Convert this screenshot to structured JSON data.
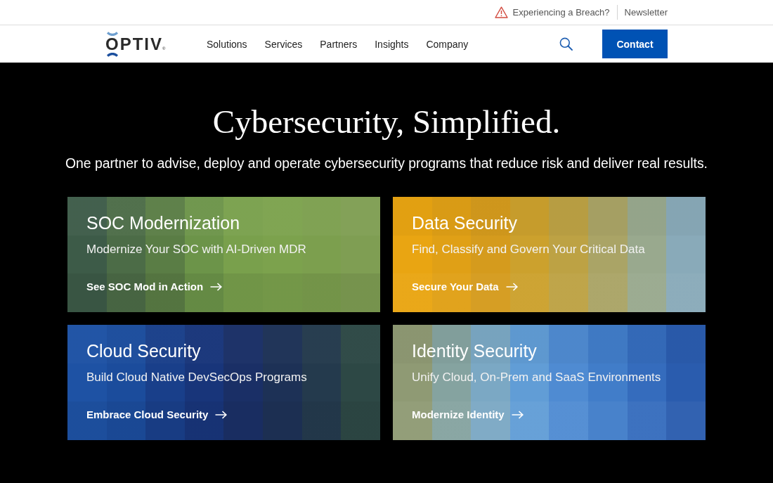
{
  "utility_bar": {
    "items": [
      {
        "kind": "alert",
        "label": "Experiencing a Breach?"
      },
      {
        "kind": "plain",
        "label": "Newsletter"
      }
    ]
  },
  "header": {
    "logo": {
      "text": "OPTIV",
      "mark": "®"
    },
    "nav": [
      "Solutions",
      "Services",
      "Partners",
      "Insights",
      "Company"
    ],
    "contact_button": "Contact"
  },
  "hero": {
    "title": "Cybersecurity, Simplified.",
    "subtitle": "One partner to advise, deploy and operate cybersecurity programs that reduce risk and deliver real results."
  },
  "cards": [
    {
      "title": "SOC Modernization",
      "subtitle": "Modernize Your SOC with AI-Driven MDR",
      "link": "See SOC Mod in Action"
    },
    {
      "title": "Data Security",
      "subtitle": "Find, Classify and Govern Your Critical Data",
      "link": "Secure Your Data"
    },
    {
      "title": "Cloud Security",
      "subtitle": "Build Cloud Native DevSecOps Programs",
      "link": "Embrace Cloud Security"
    },
    {
      "title": "Identity Security",
      "subtitle": "Unify Cloud, On-Prem and SaaS Environments",
      "link": "Modernize Identity"
    }
  ]
}
